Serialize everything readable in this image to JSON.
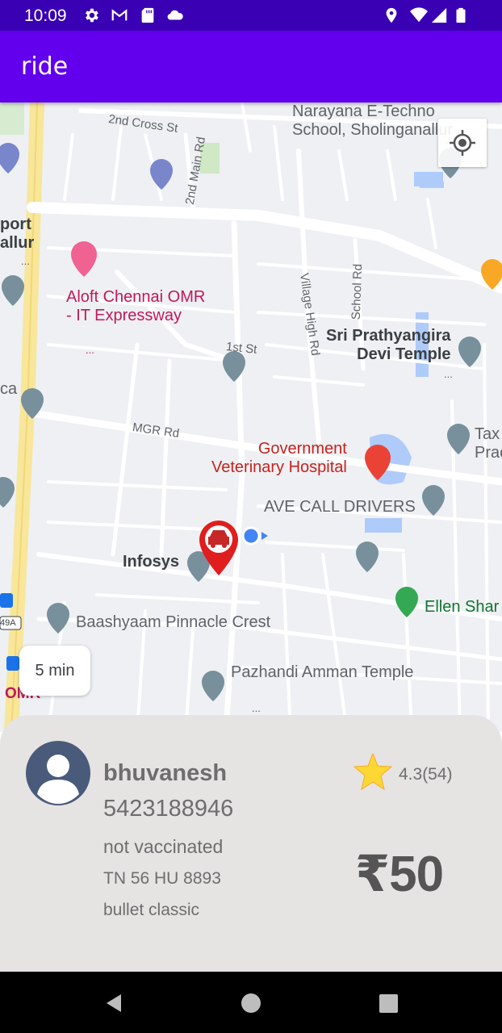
{
  "status_bar": {
    "time": "10:09",
    "left_icons": [
      "settings-icon",
      "gmail-icon",
      "sd-card-icon",
      "cloud-icon"
    ],
    "right_icons": [
      "location-icon",
      "wifi-icon",
      "signal-icon",
      "battery-icon"
    ]
  },
  "app_bar": {
    "title": "ride",
    "color": "#6200ee"
  },
  "map": {
    "labels": {
      "narayana": "Narayana E-Techno\nSchool, Sholinganallur",
      "second_cross": "2nd Cross St",
      "second_main": "2nd Main Rd",
      "port": "port\nallur",
      "aloft": "Aloft Chennai OMR\n- IT Expressway",
      "village_high": "Village High Rd",
      "school_rd": "School Rd",
      "prathyangira": "Sri Prathyangira\nDevi Temple",
      "first_st": "1st St",
      "ca": "ca",
      "mgr_rd": "MGR Rd",
      "govt_vet": "Government\nVeterinary Hospital",
      "tax": "Tax\nPrac",
      "ave_call": "AVE CALL DRIVERS",
      "infosys": "Infosys",
      "ellen": "Ellen Shar",
      "baashyaam": "Baashyaam Pinnacle Crest",
      "pazhandi": "Pazhandi Amman Temple",
      "route_49a": "49A",
      "omr": "OMR",
      "dots1": "...",
      "dots2": "...",
      "dots3": "...",
      "dots4": "...",
      "dots5": "..."
    },
    "eta_chip": "5 min",
    "marker_icon": "car-icon",
    "my_location_icon": "my-location-icon"
  },
  "driver": {
    "name": "bhuvanesh",
    "phone": "5423188946",
    "vaccination": "not vaccinated",
    "plate": "TN 56 HU 8893",
    "vehicle": "bullet classic",
    "rating": "4.3(54)",
    "fare": "₹50",
    "avatar_icon": "person-avatar-icon",
    "star_icon": "star-icon",
    "star_color": "#fdd835"
  },
  "nav": {
    "icons": [
      "back-icon",
      "home-icon",
      "recents-icon"
    ]
  }
}
